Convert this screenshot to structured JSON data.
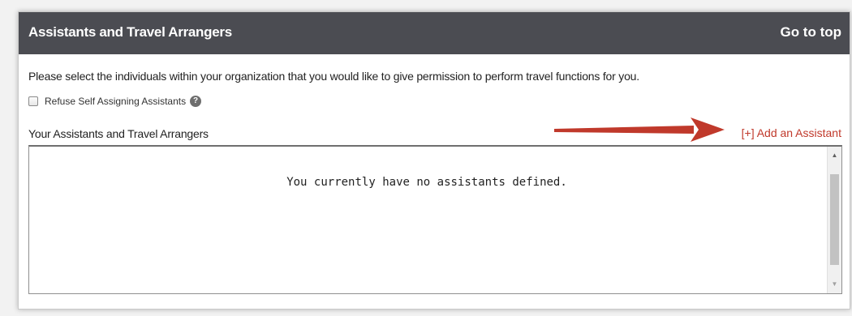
{
  "header": {
    "title": "Assistants and Travel Arrangers",
    "go_to_top": "Go to top"
  },
  "intro_text": "Please select the individuals within your organization that you would like to give permission to perform travel functions for you.",
  "refuse_option": {
    "label": "Refuse Self Assigning Assistants",
    "checked": false,
    "help_icon": "?"
  },
  "assistants_section": {
    "label": "Your Assistants and Travel Arrangers",
    "add_link": "[+] Add an Assistant",
    "empty_message": "You currently have no assistants defined."
  },
  "scrollbar": {
    "up": "▲",
    "down": "▼"
  },
  "colors": {
    "header_bg": "#4b4c52",
    "link": "#c0392b",
    "annotation_arrow": "#c0392b"
  }
}
